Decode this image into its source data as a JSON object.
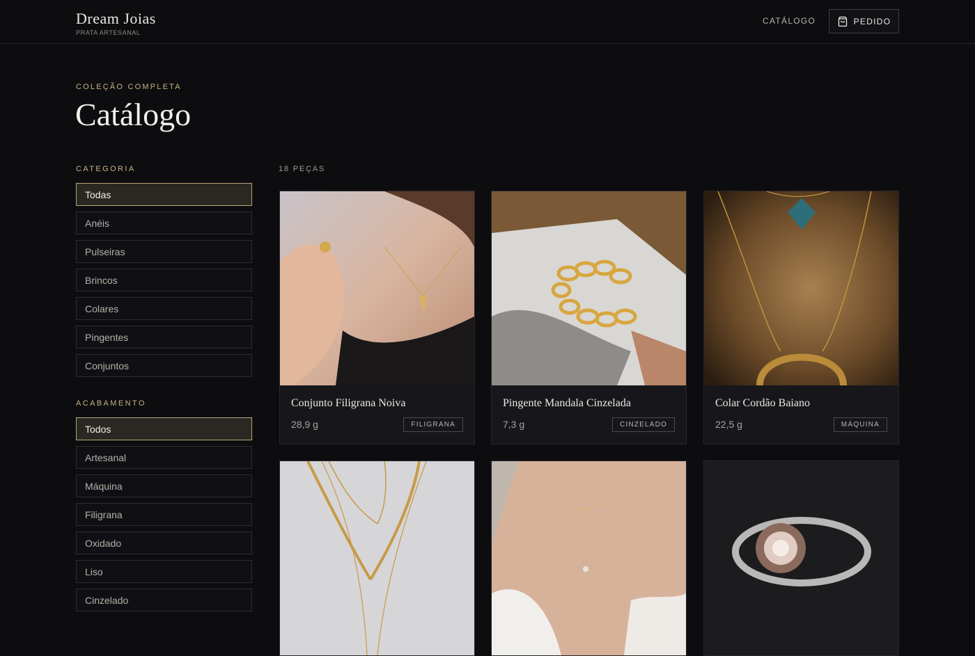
{
  "header": {
    "brand_name": "Dream Joias",
    "brand_tagline": "PRATA ARTESANAL",
    "nav_catalog": "CATÁLOGO",
    "order_label": "PEDIDO",
    "order_icon": "shopping-bag-icon"
  },
  "page": {
    "eyebrow": "COLEÇÃO COMPLETA",
    "title": "Catálogo"
  },
  "filters": {
    "category": {
      "title": "CATEGORIA",
      "items": [
        "Todas",
        "Anéis",
        "Pulseiras",
        "Brincos",
        "Colares",
        "Pingentes",
        "Conjuntos"
      ],
      "selected": "Todas"
    },
    "finish": {
      "title": "ACABAMENTO",
      "items": [
        "Todos",
        "Artesanal",
        "Máquina",
        "Filigrana",
        "Oxidado",
        "Liso",
        "Cinzelado"
      ],
      "selected": "Todos"
    }
  },
  "results": {
    "count_label": "18 PEÇAS"
  },
  "products": [
    {
      "name": "Conjunto Filigrana Noiva",
      "weight": "28,9 g",
      "badge": "FILIGRANA"
    },
    {
      "name": "Pingente Mandala Cinzelada",
      "weight": "7,3 g",
      "badge": "CINZELADO"
    },
    {
      "name": "Colar Cordão Baiano",
      "weight": "22,5 g",
      "badge": "MÁQUINA"
    },
    {
      "name": "",
      "weight": "",
      "badge": ""
    },
    {
      "name": "",
      "weight": "",
      "badge": ""
    },
    {
      "name": "",
      "weight": "",
      "badge": ""
    }
  ],
  "colors": {
    "background": "#0d0d10",
    "accent_gold": "#c9b583",
    "card": "#17171b"
  }
}
